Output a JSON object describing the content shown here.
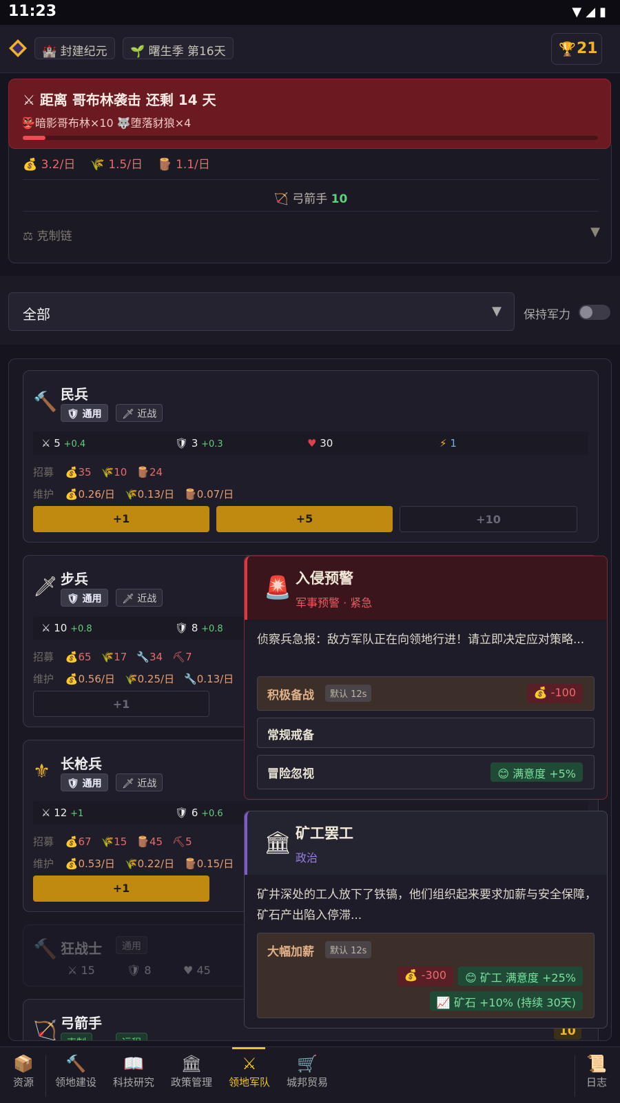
{
  "status_bar": {
    "time": "11:23",
    "icons": "▼◢▮"
  },
  "header": {
    "era": "🏰 封建纪元",
    "season": "🌱 曙生季 第16天",
    "trophy_count": "21"
  },
  "invasion_banner": {
    "title": "⚔ 距离 哥布林袭击 还剩 14 天",
    "enemies": "👺暗影哥布林×10  🐺堕落豺狼×4",
    "progress": 0.04
  },
  "army_summary": {
    "income": [
      "💰 3.2/日",
      "🌾 1.5/日",
      "🪵 1.1/日"
    ],
    "archer_label": "🏹 弓箭手",
    "archer_count": "10",
    "restrain_chain": "⚖ 克制链"
  },
  "filter": {
    "selected": "全部",
    "keep_force_label": "保持军力",
    "keep_force_on": false
  },
  "units": [
    {
      "name": "民兵",
      "icon": "🔨",
      "tag_common": "通用",
      "tag_type": "近战",
      "attack": "5",
      "attack_delta": "+0.4",
      "defense": "3",
      "defense_delta": "+0.3",
      "hp": "30",
      "speed": "1",
      "recruit_label": "招募",
      "recruit": [
        "💰35",
        "🌾10",
        "🪵24"
      ],
      "upkeep_label": "维护",
      "upkeep": [
        "💰0.26/日",
        "🌾0.13/日",
        "🪵0.07/日"
      ],
      "buttons": [
        "+1",
        "+5",
        "+10"
      ]
    },
    {
      "name": "步兵",
      "icon": "🗡",
      "tag_common": "通用",
      "tag_type": "近战",
      "attack": "10",
      "attack_delta": "+0.8",
      "defense": "8",
      "defense_delta": "+0.8",
      "recruit_label": "招募",
      "recruit": [
        "💰65",
        "🌾17",
        "🔧34",
        "⛏7"
      ],
      "upkeep_label": "维护",
      "upkeep": [
        "💰0.56/日",
        "🌾0.25/日",
        "🔧0.13/日"
      ],
      "buttons": [
        "+1"
      ]
    },
    {
      "name": "长枪兵",
      "icon": "⚜",
      "tag_common": "通用",
      "tag_type": "近战",
      "attack": "12",
      "attack_delta": "+1",
      "defense": "6",
      "defense_delta": "+0.6",
      "recruit_label": "招募",
      "recruit": [
        "💰67",
        "🌾15",
        "🪵45",
        "⛏5"
      ],
      "upkeep_label": "维护",
      "upkeep": [
        "💰0.53/日",
        "🌾0.22/日",
        "🪵0.15/日"
      ],
      "buttons": [
        "+1"
      ]
    },
    {
      "name": "狂战士",
      "icon": "🔨",
      "tag_common": "通用",
      "attack": "15",
      "defense": "8",
      "hp": "45"
    },
    {
      "name": "弓箭手",
      "icon": "🏹",
      "tag_common": "克制",
      "tag_type": "远程",
      "count": "10"
    }
  ],
  "alert_dialog": {
    "icon": "🚨",
    "title": "入侵预警",
    "subtitle": "军事预警 · 紧急",
    "body": "侦察兵急报：敌方军队正在向领地行进！请立即决定应对策略...",
    "options": [
      {
        "label": "积极备战",
        "default": "默认 12s",
        "cost": "💰 -100"
      },
      {
        "label": "常规戒备"
      },
      {
        "label": "冒险忽视",
        "effect": "😊 满意度 +5%"
      }
    ]
  },
  "strike_dialog": {
    "icon": "🏛",
    "title": "矿工罢工",
    "subtitle": "政治",
    "body": "矿井深处的工人放下了铁镐，他们组织起来要求加薪与安全保障，矿石产出陷入停滞...",
    "option": {
      "label": "大幅加薪",
      "default": "默认 12s",
      "cost": "💰 -300",
      "effect1": "😊 矿工 满意度 +25%",
      "effect2": "📈 矿石 +10% (持续 30天)"
    }
  },
  "bottom_nav": [
    {
      "icon": "📦",
      "label": "资源"
    },
    {
      "icon": "🔨",
      "label": "领地建设"
    },
    {
      "icon": "📖",
      "label": "科技研究"
    },
    {
      "icon": "🏛",
      "label": "政策管理"
    },
    {
      "icon": "⚔",
      "label": "领地军队",
      "active": true
    },
    {
      "icon": "🛒",
      "label": "城邦贸易"
    },
    {
      "icon": "📜",
      "label": "日志"
    }
  ]
}
